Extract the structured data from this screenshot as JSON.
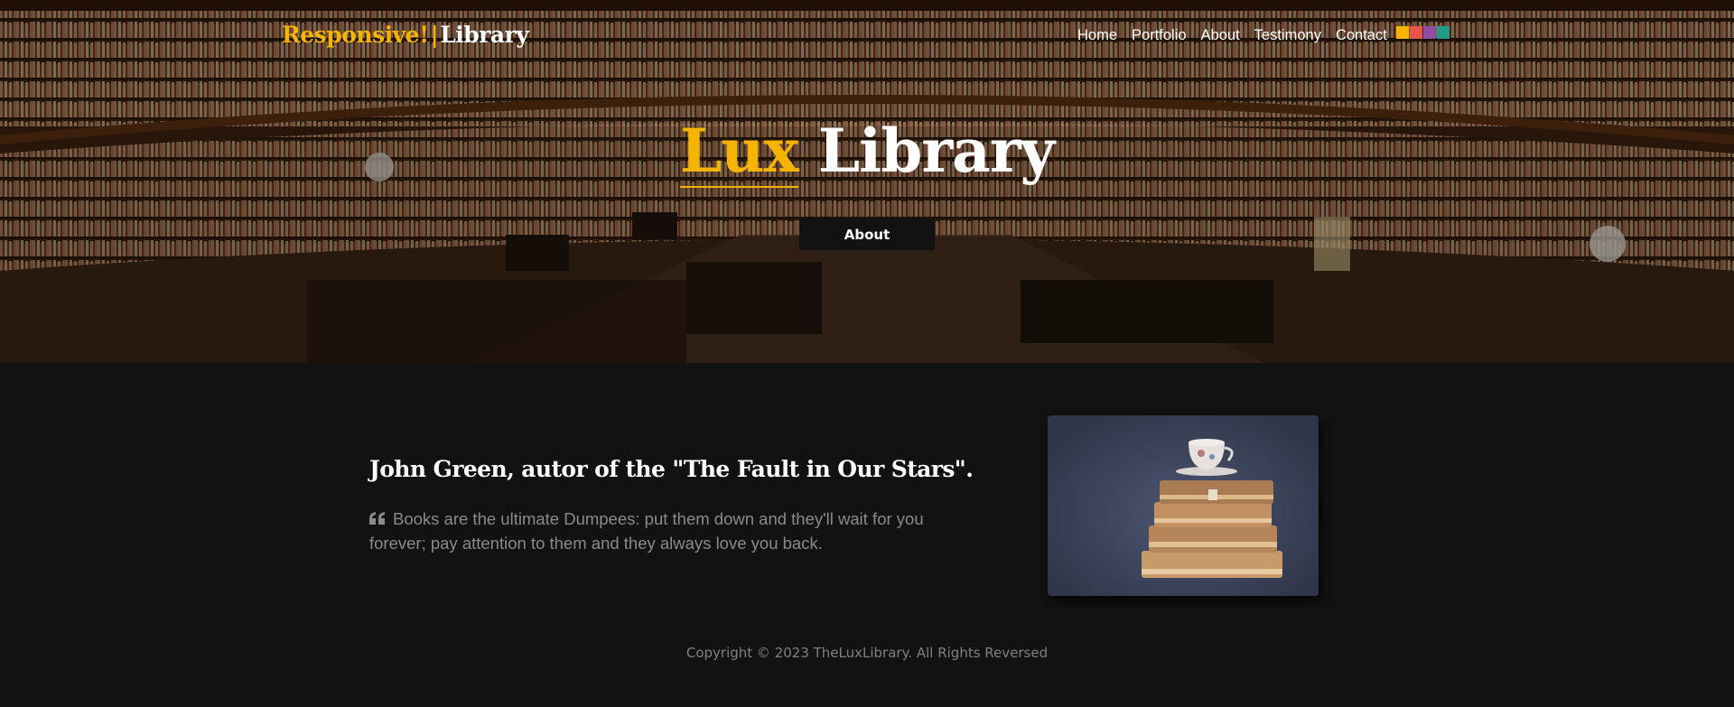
{
  "header": {
    "brand_accent": "Responsive!",
    "brand_separator": "|",
    "brand_rest": "Library",
    "nav": [
      {
        "label": "Home"
      },
      {
        "label": "Portfolio"
      },
      {
        "label": "About"
      },
      {
        "label": "Testimony"
      },
      {
        "label": "Contact"
      }
    ],
    "theme_swatches": [
      "#f5b400",
      "#e8534a",
      "#8e4ea3",
      "#1f9c86"
    ]
  },
  "hero": {
    "title_accent": "Lux",
    "title_rest": "Library",
    "button_label": "About"
  },
  "testimony": {
    "heading": "John Green, autor of the \"The Fault in Our Stars\".",
    "quote": "Books are the ultimate Dumpees: put them down and they'll wait for you forever; pay attention to them and they always love you back.",
    "quote_icon": "quote-left-icon"
  },
  "footer": {
    "copyright": "Copyright © 2023 TheLuxLibrary. All Rights Reversed"
  },
  "colors": {
    "accent": "#f5b400",
    "background": "#121212",
    "text_muted": "#8a8a8a"
  }
}
